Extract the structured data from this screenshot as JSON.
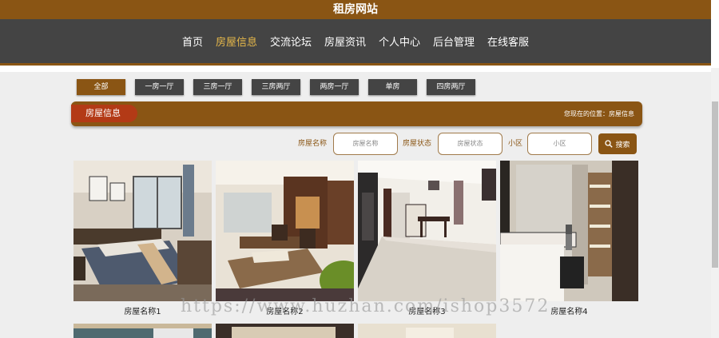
{
  "site": {
    "title": "租房网站"
  },
  "nav": {
    "items": [
      {
        "label": "首页"
      },
      {
        "label": "房屋信息"
      },
      {
        "label": "交流论坛"
      },
      {
        "label": "房屋资讯"
      },
      {
        "label": "个人中心"
      },
      {
        "label": "后台管理"
      },
      {
        "label": "在线客服"
      }
    ],
    "active": "房屋信息"
  },
  "categories": {
    "items": [
      {
        "label": "全部"
      },
      {
        "label": "一房一厅"
      },
      {
        "label": "三房一厅"
      },
      {
        "label": "三房两厅"
      },
      {
        "label": "两房一厅"
      },
      {
        "label": "单房"
      },
      {
        "label": "四房两厅"
      }
    ],
    "active": "全部"
  },
  "section": {
    "title": "房屋信息",
    "breadcrumb": "您现在的位置：房屋信息"
  },
  "search": {
    "fields": [
      {
        "label": "房屋名称",
        "placeholder": "房屋名称"
      },
      {
        "label": "房屋状态",
        "placeholder": "房屋状态"
      },
      {
        "label": "小区",
        "placeholder": "小区"
      }
    ],
    "button_label": "搜索",
    "button_icon": "search-icon"
  },
  "listings": [
    {
      "name": "房屋名称1"
    },
    {
      "name": "房屋名称2"
    },
    {
      "name": "房屋名称3"
    },
    {
      "name": "房屋名称4"
    }
  ],
  "watermark": "https://www.huzhan.com/ishop3572",
  "colors": {
    "brand": "#8a5514",
    "nav_bg": "#444444",
    "accent_pill": "#b33a16",
    "nav_active": "#e6b84a"
  }
}
